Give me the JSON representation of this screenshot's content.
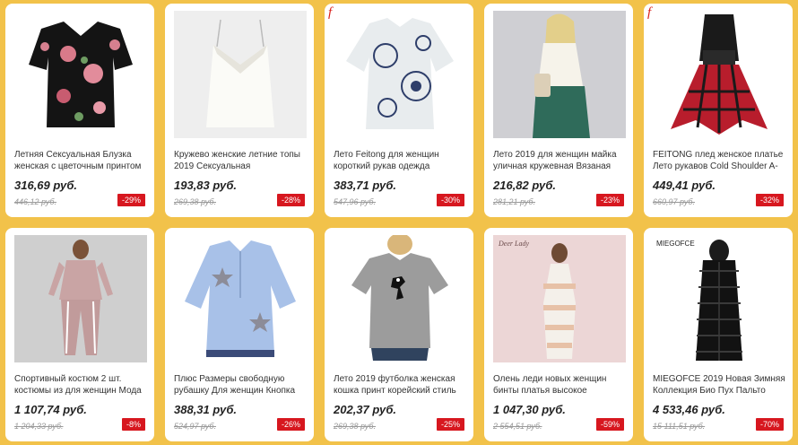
{
  "products": [
    {
      "title": "Летняя Сексуальная Блузка женская с цветочным принтом",
      "price": "316,69 руб.",
      "old_price": "446,12 руб.",
      "discount": "-29%",
      "brand_mark": "",
      "image_icon": "floral-blouse-image"
    },
    {
      "title": "Кружево женские летние топы 2019 Сексуальная",
      "price": "193,83 руб.",
      "old_price": "269,38 руб.",
      "discount": "-28%",
      "brand_mark": "",
      "image_icon": "lace-camisole-image"
    },
    {
      "title": "Лето Feitong для женщин короткий рукав одежда",
      "price": "383,71 руб.",
      "old_price": "547,96 руб.",
      "discount": "-30%",
      "brand_mark": "f",
      "image_icon": "printed-tunic-image"
    },
    {
      "title": "Лето 2019 для женщин майка уличная кружевная Вязаная",
      "price": "216,82 руб.",
      "old_price": "281,21 руб.",
      "discount": "-23%",
      "brand_mark": "",
      "image_icon": "woman-lace-top-image"
    },
    {
      "title": "FEITONG плед женское платье Лето рукавов Cold Shoulder A-",
      "price": "449,41 руб.",
      "old_price": "660,97 руб.",
      "discount": "-32%",
      "brand_mark": "f",
      "image_icon": "plaid-dress-image"
    },
    {
      "title": "Спортивный костюм 2 шт. костюмы из для женщин Мода",
      "price": "1 107,74 руб.",
      "old_price": "1 204,33 руб.",
      "discount": "-8%",
      "brand_mark": "",
      "image_icon": "tracksuit-image"
    },
    {
      "title": "Плюс Размеры свободную рубашку Для женщин Кнопка",
      "price": "388,31 руб.",
      "old_price": "524,97 руб.",
      "discount": "-26%",
      "brand_mark": "",
      "image_icon": "blue-shirt-image"
    },
    {
      "title": "Лето 2019 футболка женская кошка принт корейский стиль",
      "price": "202,37 руб.",
      "old_price": "269,38 руб.",
      "discount": "-25%",
      "brand_mark": "",
      "image_icon": "cat-tshirt-image"
    },
    {
      "title": "Олень леди новых женщин бинты платья высокое",
      "price": "1 047,30 руб.",
      "old_price": "2 554,51 руб.",
      "discount": "-59%",
      "brand_mark": "",
      "image_icon": "bandage-dress-image",
      "image_text": "Deer Lady"
    },
    {
      "title": "MIEGOFCE 2019 Новая Зимняя Коллекция Био Пух Пальто",
      "price": "4 533,46 руб.",
      "old_price": "15 111,51 руб.",
      "discount": "-70%",
      "brand_mark": "",
      "image_icon": "puffer-coat-image",
      "image_text": "MIEGOFCE"
    }
  ]
}
